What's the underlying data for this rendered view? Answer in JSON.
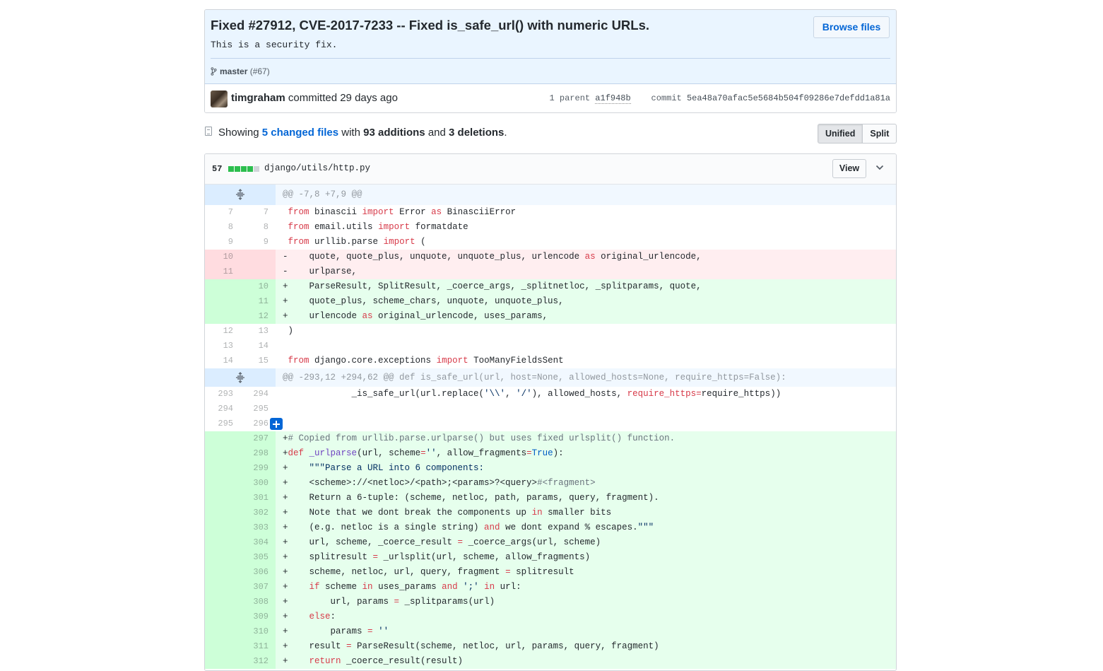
{
  "commit": {
    "title": "Fixed #27912, CVE-2017-7233 -- Fixed is_safe_url() with numeric URLs.",
    "description": "This is a security fix.",
    "browse_button": "Browse files",
    "branch": "master",
    "pull": "(#67)",
    "author": "timgraham",
    "action": "committed",
    "time_ago": "29 days ago",
    "parent_label": "1 parent",
    "parent_sha": "a1f948b",
    "commit_label": "commit",
    "commit_sha": "5ea48a70afac5e5684b504f09286e7defdd1a81a"
  },
  "toc": {
    "showing": "Showing",
    "changed_files": "5 changed files",
    "with": "with",
    "additions": "93 additions",
    "and": "and",
    "deletions": "3 deletions",
    "period": ".",
    "unified_button": "Unified",
    "split_button": "Split"
  },
  "file": {
    "changes": "57",
    "path": "django/utils/http.py",
    "view_button": "View",
    "diffstat": {
      "added_blocks": 4,
      "neutral_blocks": 1
    }
  },
  "colors": {
    "accent": "#0366d6",
    "addition_bg": "#e6ffed",
    "deletion_bg": "#ffeef0",
    "hunk_bg": "#f1f8ff"
  },
  "icons": {
    "branch": "git-branch-icon",
    "toc": "file-diff-icon",
    "expand": "unfold-icon",
    "chevron": "chevron-down-icon",
    "add_comment": "plus-icon"
  },
  "diff": {
    "hunk1": "@@ -7,8 +7,9 @@",
    "hunk2": "@@ -293,12 +294,62 @@ def is_safe_url(url, host=None, allowed_hosts=None, require_https=False):",
    "lines": [
      {
        "type": "ctx",
        "old": "7",
        "new": "7"
      },
      {
        "type": "ctx",
        "old": "8",
        "new": "8"
      },
      {
        "type": "ctx",
        "old": "9",
        "new": "9"
      },
      {
        "type": "del",
        "old": "10",
        "new": ""
      },
      {
        "type": "del",
        "old": "11",
        "new": ""
      },
      {
        "type": "add",
        "old": "",
        "new": "10"
      },
      {
        "type": "add",
        "old": "",
        "new": "11"
      },
      {
        "type": "add",
        "old": "",
        "new": "12"
      },
      {
        "type": "ctx",
        "old": "12",
        "new": "13"
      },
      {
        "type": "ctx",
        "old": "13",
        "new": "14"
      },
      {
        "type": "ctx",
        "old": "14",
        "new": "15"
      }
    ],
    "lines2": [
      {
        "type": "ctx",
        "old": "293",
        "new": "294"
      },
      {
        "type": "ctx",
        "old": "294",
        "new": "295"
      },
      {
        "type": "ctx",
        "old": "295",
        "new": "296"
      },
      {
        "type": "add",
        "old": "",
        "new": "297"
      },
      {
        "type": "add",
        "old": "",
        "new": "298"
      },
      {
        "type": "add",
        "old": "",
        "new": "299"
      },
      {
        "type": "add",
        "old": "",
        "new": "300"
      },
      {
        "type": "add",
        "old": "",
        "new": "301"
      },
      {
        "type": "add",
        "old": "",
        "new": "302"
      },
      {
        "type": "add",
        "old": "",
        "new": "303"
      },
      {
        "type": "add",
        "old": "",
        "new": "304"
      },
      {
        "type": "add",
        "old": "",
        "new": "305"
      },
      {
        "type": "add",
        "old": "",
        "new": "306"
      },
      {
        "type": "add",
        "old": "",
        "new": "307"
      },
      {
        "type": "add",
        "old": "",
        "new": "308"
      },
      {
        "type": "add",
        "old": "",
        "new": "309"
      },
      {
        "type": "add",
        "old": "",
        "new": "310"
      },
      {
        "type": "add",
        "old": "",
        "new": "311"
      },
      {
        "type": "add",
        "old": "",
        "new": "312"
      }
    ],
    "code": [
      " from binascii import Error as BinasciiError",
      " from email.utils import formatdate",
      " from urllib.parse import (",
      "-    quote, quote_plus, unquote, unquote_plus, urlencode as original_urlencode,",
      "-    urlparse,",
      "+    ParseResult, SplitResult, _coerce_args, _splitnetloc, _splitparams, quote,",
      "+    quote_plus, scheme_chars, unquote, unquote_plus,",
      "+    urlencode as original_urlencode, uses_params,",
      " )",
      " ",
      " from django.core.exceptions import TooManyFieldsSent"
    ],
    "code2": [
      "             _is_safe_url(url.replace('\\\\', '/'), allowed_hosts, require_https=require_https))",
      " ",
      " ",
      "+# Copied from urllib.parse.urlparse() but uses fixed urlsplit() function.",
      "+def _urlparse(url, scheme='', allow_fragments=True):",
      "+    \"\"\"Parse a URL into 6 components:",
      "+    <scheme>://<netloc>/<path>;<params>?<query>#<fragment>",
      "+    Return a 6-tuple: (scheme, netloc, path, params, query, fragment).",
      "+    Note that we don't break the components up in smaller bits",
      "+    (e.g. netloc is a single string) and we don't expand % escapes.\"\"\"",
      "+    url, scheme, _coerce_result = _coerce_args(url, scheme)",
      "+    splitresult = _urlsplit(url, scheme, allow_fragments)",
      "+    scheme, netloc, url, query, fragment = splitresult",
      "+    if scheme in uses_params and ';' in url:",
      "+        url, params = _splitparams(url)",
      "+    else:",
      "+        params = ''",
      "+    result = ParseResult(scheme, netloc, url, params, query, fragment)",
      "+    return _coerce_result(result)"
    ]
  }
}
